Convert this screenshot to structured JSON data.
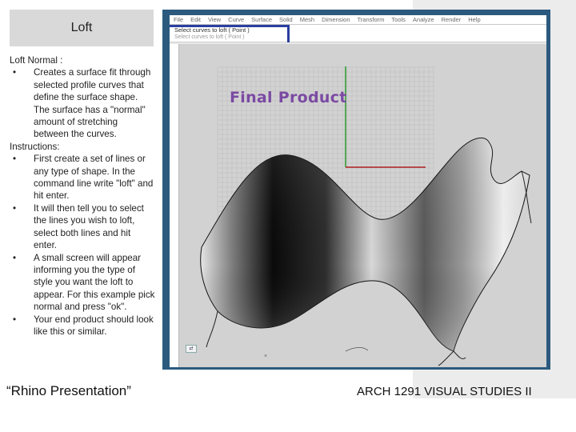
{
  "slide": {
    "title": "Loft",
    "heading": "Loft Normal :",
    "bullets_intro": [
      "Creates a surface fit through selected profile curves that define the surface shape. The surface has a \"normal\" amount of stretching between the curves."
    ],
    "instructions_label": "Instructions:",
    "bullets_steps": [
      "First create a set of lines or any type of shape. In the command line write \"loft\" and hit enter.",
      "It will then tell you to select the lines you wish to loft, select both lines and hit enter.",
      "A small screen will appear informing you the type of style you want the loft to appear. For this example pick normal and press \"ok\".",
      "Your end product should look like this or similar."
    ],
    "bullet_char": "•",
    "footer_left": "“Rhino Presentation”",
    "footer_right": "ARCH 1291 VISUAL STUDIES II"
  },
  "app": {
    "menu": [
      "File",
      "Edit",
      "View",
      "Curve",
      "Surface",
      "Solid",
      "Mesh",
      "Dimension",
      "Transform",
      "Tools",
      "Analyze",
      "Render",
      "Help"
    ],
    "command_prompt": "Select curves to loft ( Point )",
    "command_prompt_faded": "Select curves to loft ( Point )",
    "overlay_label": "Final Product",
    "small_icon_label": "⇄",
    "x_axis_color": "#b02020",
    "y_axis_color": "#2a9a2a",
    "frame_color": "#2c5a7e",
    "label_color": "#7b4aa3"
  }
}
